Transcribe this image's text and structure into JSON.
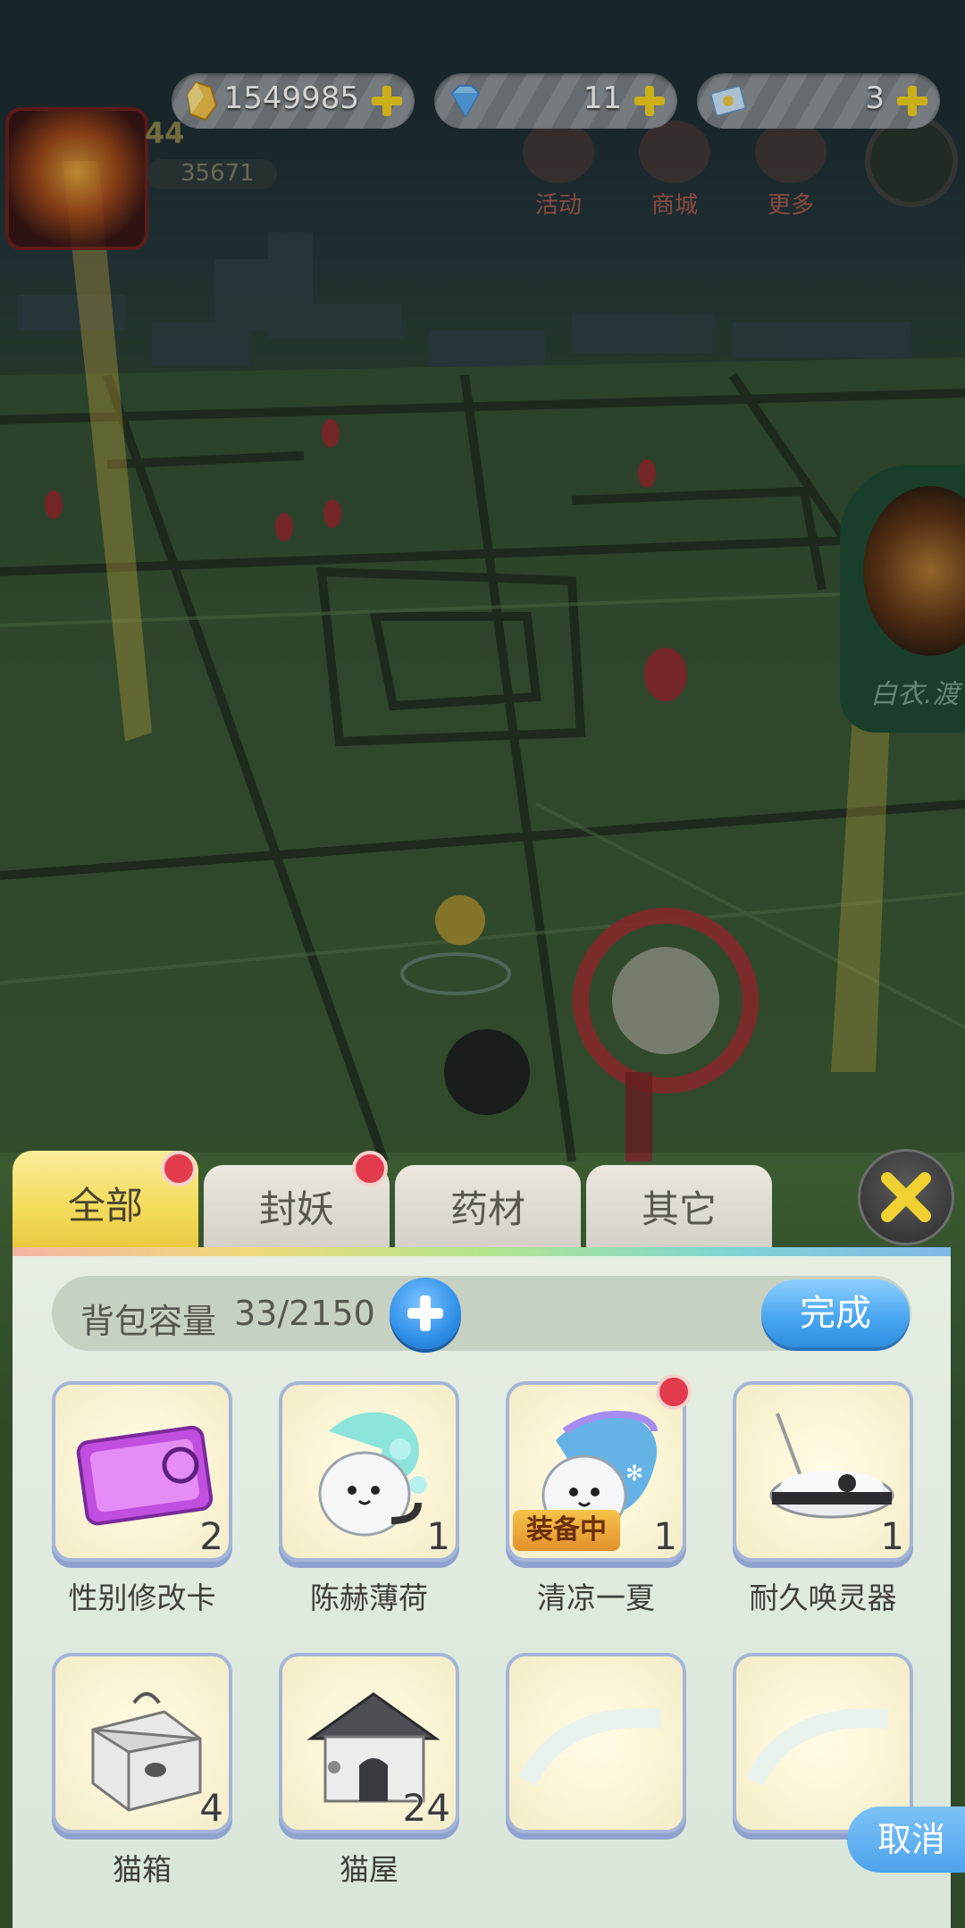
{
  "currency": {
    "gold": {
      "value": "1549985",
      "icon": "gold-crystal-icon"
    },
    "diamond": {
      "value": "11",
      "icon": "diamond-icon"
    },
    "ticket": {
      "value": "3",
      "icon": "ticket-icon"
    }
  },
  "player": {
    "level": "44",
    "power": "35671"
  },
  "top_menu": [
    {
      "label": "活动",
      "icon": "gift-icon"
    },
    {
      "label": "商城",
      "icon": "shop-icon"
    },
    {
      "label": "更多",
      "icon": "grid-icon"
    }
  ],
  "side_card_label": "白衣.渡",
  "tabs": [
    {
      "label": "全部",
      "active": true,
      "badge": true
    },
    {
      "label": "封妖",
      "active": false,
      "badge": true
    },
    {
      "label": "药材",
      "active": false,
      "badge": false
    },
    {
      "label": "其它",
      "active": false,
      "badge": false
    }
  ],
  "bag": {
    "capacity_label": "背包容量",
    "capacity_value": "33/2150",
    "done_label": "完成",
    "cancel_label": "取消"
  },
  "items": [
    {
      "name": "性别修改卡",
      "qty": "2",
      "icon": "gender-card-icon"
    },
    {
      "name": "陈赫薄荷",
      "qty": "1",
      "icon": "mint-spirit-icon"
    },
    {
      "name": "清凉一夏",
      "qty": "1",
      "icon": "cool-summer-spirit-icon",
      "equipped_label": "装备中",
      "badge": true
    },
    {
      "name": "耐久唤灵器",
      "qty": "1",
      "icon": "summoner-device-icon"
    },
    {
      "name": "猫箱",
      "qty": "4",
      "icon": "cat-box-icon"
    },
    {
      "name": "猫屋",
      "qty": "24",
      "icon": "cat-house-icon"
    }
  ],
  "colors": {
    "tab_active": "#f3dc5b",
    "panel": "#e0ebdd",
    "accent_blue": "#4aa7f0",
    "badge_red": "#e23b4d",
    "slot_border": "#a5b5d9"
  }
}
